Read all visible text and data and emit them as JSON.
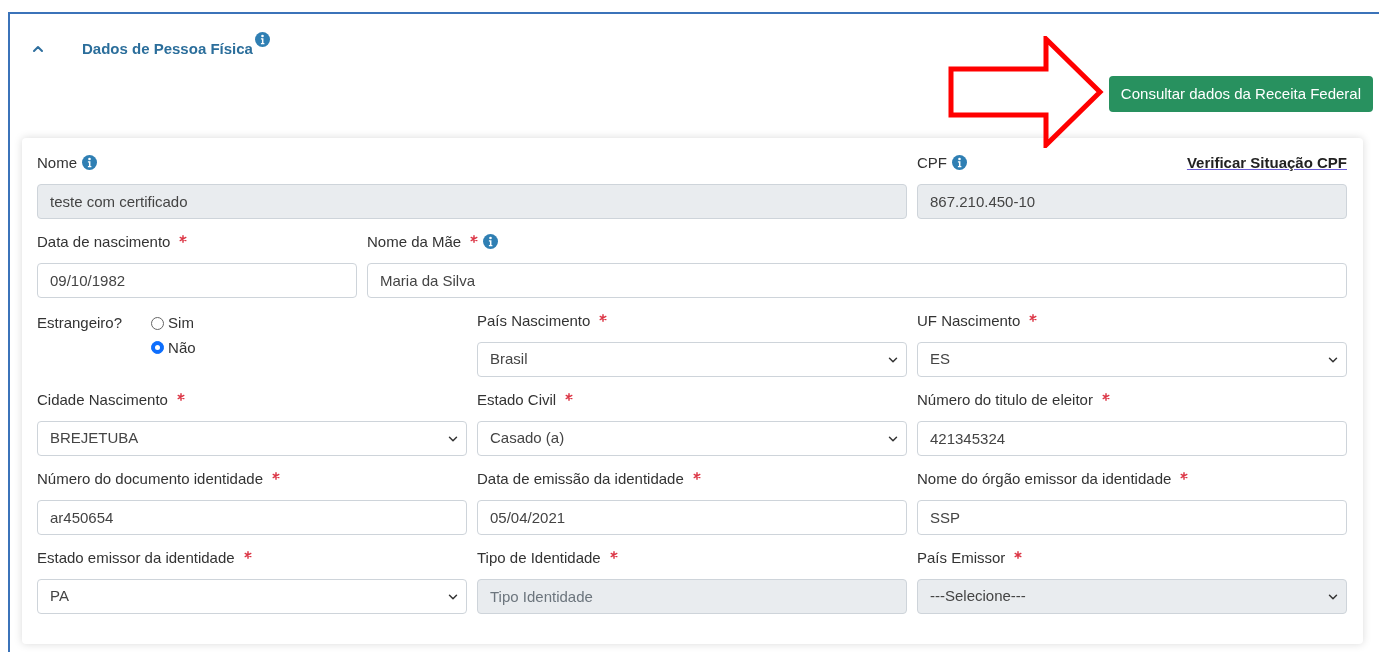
{
  "section": {
    "title": "Dados de Pessoa Física",
    "expanded": true,
    "info": true
  },
  "consult_button": "Consultar dados da Receita Federal",
  "rows": [
    {
      "fields": [
        {
          "kind": "text",
          "label": "Nome",
          "required": false,
          "info": true,
          "value": "teste com certificado",
          "disabled": true
        },
        {
          "kind": "text",
          "label": "CPF",
          "required": false,
          "info": true,
          "value": "867.210.450-10",
          "disabled": true,
          "link": "Verificar Situação CPF"
        }
      ]
    },
    {
      "fields": [
        {
          "kind": "text",
          "label": "Data de nascimento",
          "required": true,
          "info": false,
          "value": "09/10/1982",
          "disabled": false
        },
        {
          "kind": "text",
          "label": "Nome da Mãe",
          "required": true,
          "info": true,
          "value": "Maria da Silva",
          "disabled": false
        }
      ]
    },
    {
      "fields": [
        {
          "kind": "radio",
          "label": "Estrangeiro?",
          "options": [
            {
              "label": "Sim",
              "selected": false
            },
            {
              "label": "Não",
              "selected": true
            }
          ]
        },
        {
          "kind": "select",
          "label": "País Nascimento",
          "required": true,
          "info": false,
          "value": "Brasil",
          "disabled": false
        },
        {
          "kind": "select",
          "label": "UF Nascimento",
          "required": true,
          "info": false,
          "value": "ES",
          "disabled": false
        }
      ]
    },
    {
      "fields": [
        {
          "kind": "select",
          "label": "Cidade Nascimento",
          "required": true,
          "info": false,
          "value": "BREJETUBA",
          "disabled": false
        },
        {
          "kind": "select",
          "label": "Estado Civil",
          "required": true,
          "info": false,
          "value": "Casado (a)",
          "disabled": false
        },
        {
          "kind": "text",
          "label": "Número do titulo de eleitor",
          "required": true,
          "info": false,
          "value": "421345324",
          "disabled": false
        }
      ]
    },
    {
      "fields": [
        {
          "kind": "text",
          "label": "Número do documento identidade",
          "required": true,
          "info": false,
          "value": "ar450654",
          "disabled": false
        },
        {
          "kind": "text",
          "label": "Data de emissão da identidade",
          "required": true,
          "info": false,
          "value": "05/04/2021",
          "disabled": false
        },
        {
          "kind": "text",
          "label": "Nome do órgão emissor da identidade",
          "required": true,
          "info": false,
          "value": "SSP",
          "disabled": false
        }
      ]
    },
    {
      "fields": [
        {
          "kind": "select",
          "label": "Estado emissor da identidade",
          "required": true,
          "info": false,
          "value": "PA",
          "disabled": false
        },
        {
          "kind": "text",
          "label": "Tipo de Identidade",
          "required": true,
          "info": false,
          "placeholder": "Tipo Identidade",
          "disabled": true
        },
        {
          "kind": "select",
          "label": "País Emissor",
          "required": true,
          "info": false,
          "value": "---Selecione---",
          "disabled": true
        }
      ]
    }
  ]
}
